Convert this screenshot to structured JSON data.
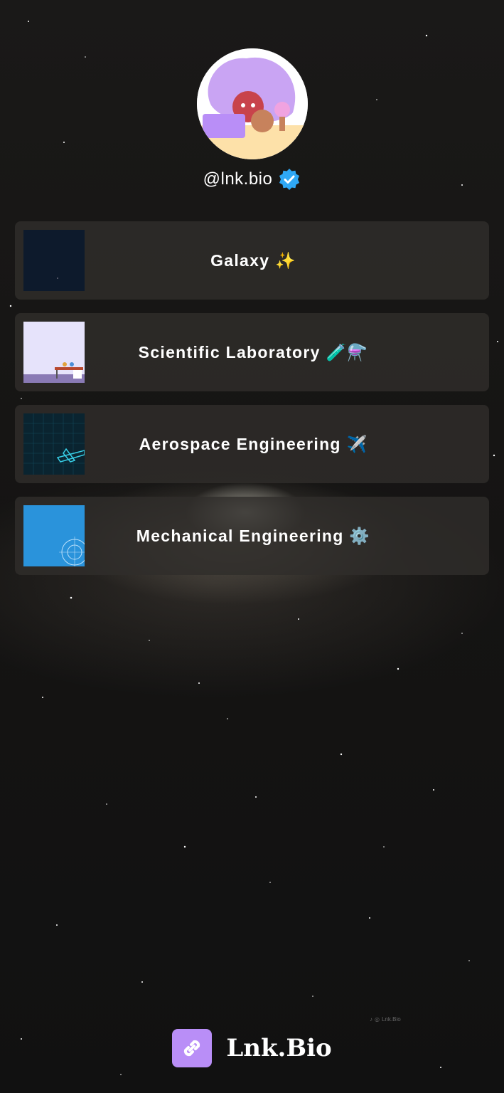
{
  "profile": {
    "handle": "@lnk.bio",
    "verified": true,
    "avatar_icon": "cartoon-avatar-illustration",
    "verified_icon": "verified-badge-icon",
    "colors": {
      "verified_badge": "#2fa8f5",
      "avatar_hair": "#c9a4f3"
    }
  },
  "links": [
    {
      "label": "Galaxy ✨",
      "thumb_icon": "galaxy-thumbnail"
    },
    {
      "label": "Scientific Laboratory 🧪⚗️",
      "thumb_icon": "laboratory-thumbnail"
    },
    {
      "label": "Aerospace Engineering ✈️",
      "thumb_icon": "aerospace-thumbnail"
    },
    {
      "label": "Mechanical Engineering ⚙️",
      "thumb_icon": "mechanical-thumbnail"
    }
  ],
  "footer": {
    "brand": "Lnk.Bio",
    "logo_icon": "link-chain-icon",
    "brand_color": "#b98ef7"
  },
  "watermark": {
    "text": "Lnk.Bio",
    "icons": [
      "tiktok-icon",
      "instagram-icon"
    ]
  },
  "colors": {
    "background": "#121110",
    "card": "#302d2b"
  }
}
